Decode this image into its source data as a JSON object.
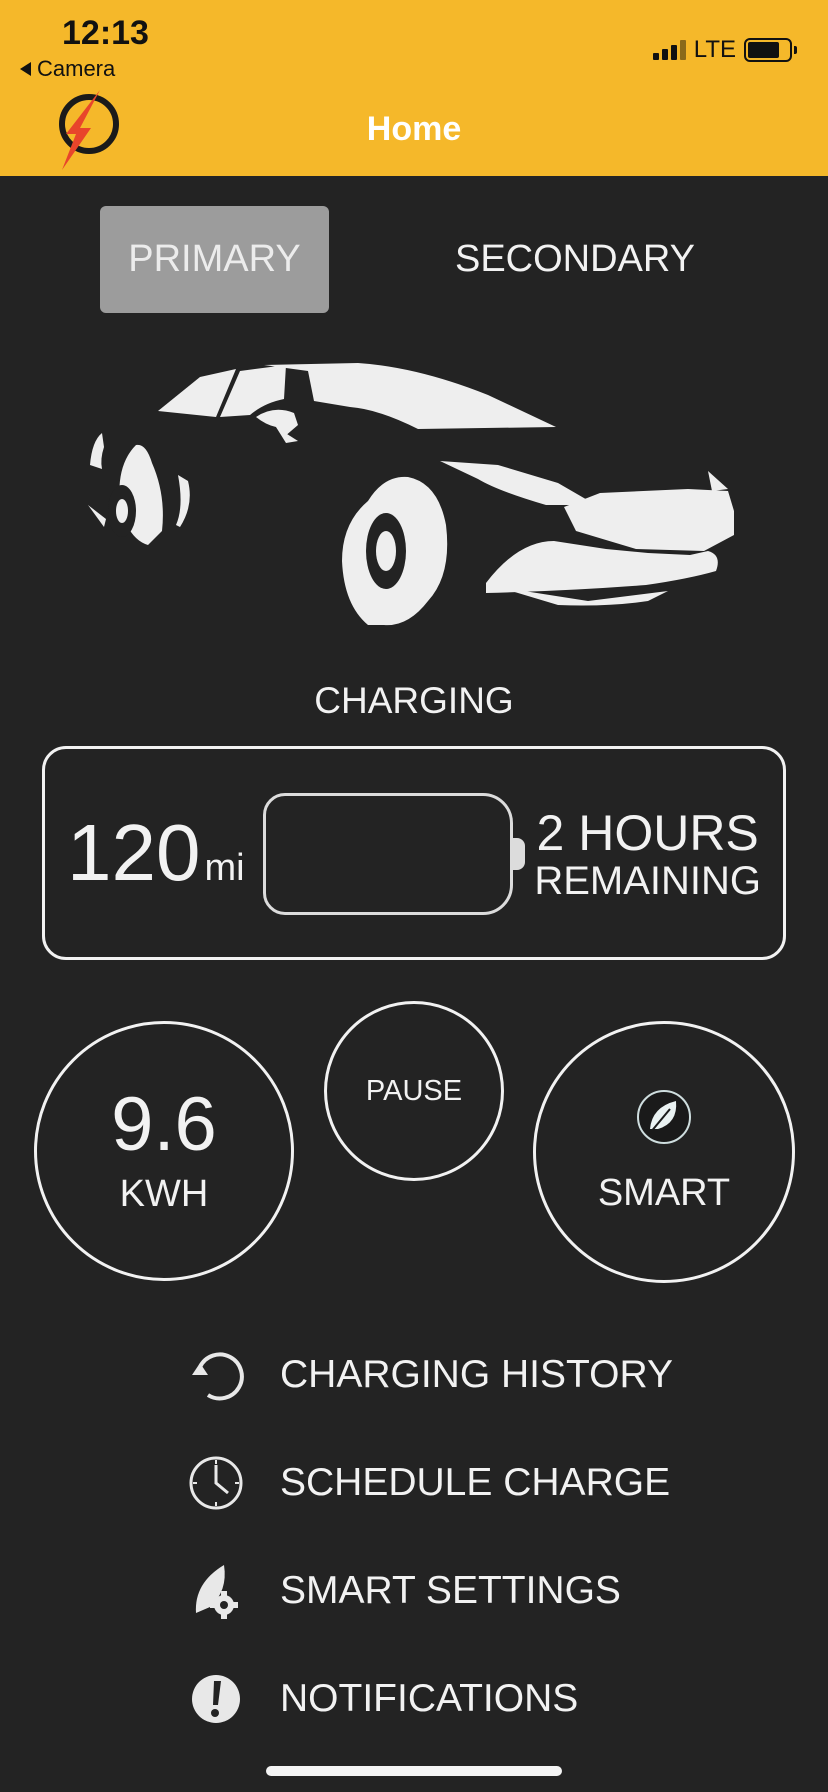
{
  "status_bar": {
    "time": "12:13",
    "back_label": "Camera",
    "network": "LTE",
    "signal_icon": "signal-bars-icon",
    "battery_icon": "battery-icon"
  },
  "header": {
    "title": "Home",
    "logo_icon": "bolt-logo-icon",
    "accent_color": "#f5b82a"
  },
  "segments": {
    "primary": "PRIMARY",
    "secondary": "SECONDARY",
    "selected": "PRIMARY"
  },
  "vehicle": {
    "image_icon": "car-silhouette-icon",
    "status": "CHARGING"
  },
  "charge": {
    "range_value": "120",
    "range_unit": "mi",
    "time_value": "2 HOURS",
    "time_label": "REMAINING",
    "battery_icon": "battery-outline-icon"
  },
  "controls": {
    "energy_value": "9.6",
    "energy_unit": "KWH",
    "pause_label": "PAUSE",
    "smart_label": "SMART",
    "smart_icon": "leaf-icon"
  },
  "menu": [
    {
      "label": "CHARGING HISTORY",
      "icon": "history-icon"
    },
    {
      "label": "SCHEDULE CHARGE",
      "icon": "clock-icon"
    },
    {
      "label": "SMART SETTINGS",
      "icon": "leaf-gear-icon"
    },
    {
      "label": "NOTIFICATIONS",
      "icon": "alert-icon"
    }
  ],
  "colors": {
    "background": "#232323",
    "header": "#f5b82a",
    "selected_segment": "#9c9c9c",
    "foreground": "#f2f2f2"
  }
}
